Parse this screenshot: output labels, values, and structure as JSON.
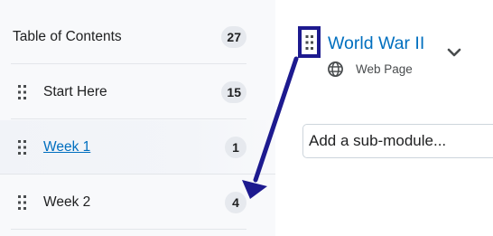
{
  "toc": {
    "header": {
      "label": "Table of Contents",
      "count": "27"
    },
    "items": [
      {
        "label": "Start Here",
        "count": "15"
      },
      {
        "label": "Week 1",
        "count": "1"
      },
      {
        "label": "Week 2",
        "count": "4"
      }
    ]
  },
  "module": {
    "title": "World War II",
    "type_label": "Web Page",
    "type_icon": "globe-icon",
    "sub_module_placeholder": "Add a sub-module..."
  },
  "colors": {
    "link": "#006fbf",
    "annotation": "#1d1a8f",
    "badge_bg": "#e6e9ee"
  }
}
